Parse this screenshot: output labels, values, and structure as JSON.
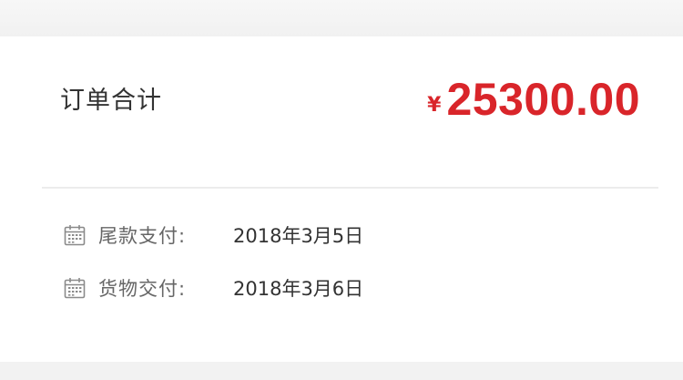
{
  "order_total": {
    "label": "订单合计",
    "currency_symbol": "¥",
    "amount": "25300.00",
    "amount_color": "#d9252a"
  },
  "payment_schedule": [
    {
      "icon": "calendar-icon",
      "label": "尾款支付:",
      "date": "2018年3月5日"
    },
    {
      "icon": "calendar-icon",
      "label": "货物交付:",
      "date": "2018年3月6日"
    }
  ]
}
